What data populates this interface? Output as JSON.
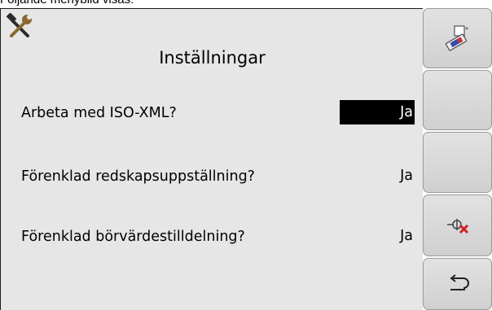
{
  "caption": "Följande menybild visas:",
  "screen": {
    "title": "Inställningar",
    "rows": [
      {
        "label": "Arbeta med ISO-XML?",
        "value": "Ja",
        "selected": true
      },
      {
        "label": "Förenklad redskapsuppställning?",
        "value": "Ja",
        "selected": false
      },
      {
        "label": "Förenklad börvärdestilldelning?",
        "value": "Ja",
        "selected": false
      }
    ]
  },
  "softkeys": [
    {
      "icon": "usb-stick-icon"
    },
    {
      "icon": null
    },
    {
      "icon": null
    },
    {
      "icon": "section-control-off-icon"
    },
    {
      "icon": "return-arrow-icon"
    }
  ],
  "colors": {
    "screen_bg": "#e6e6e6",
    "selection_bg": "#000000",
    "selection_fg": "#ffffff",
    "delete_red": "#d42020"
  }
}
